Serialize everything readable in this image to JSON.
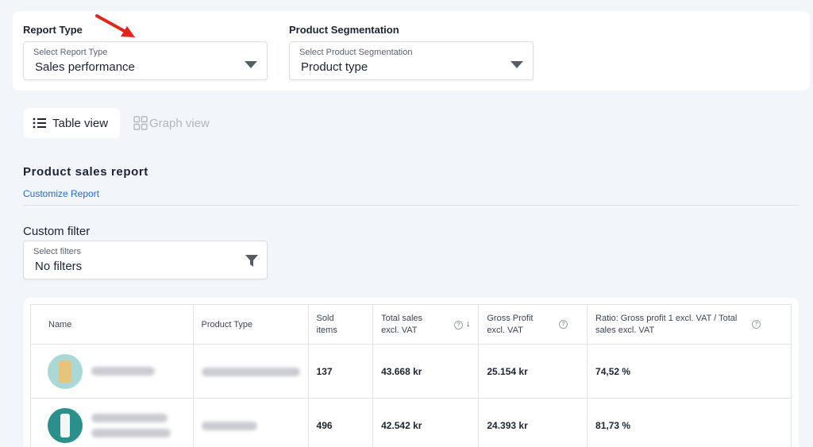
{
  "report_type": {
    "label": "Report Type",
    "caption": "Select Report Type",
    "value": "Sales performance"
  },
  "segmentation": {
    "label": "Product Segmentation",
    "caption": "Select Product Segmentation",
    "value": "Product type"
  },
  "views": {
    "table_label": "Table view",
    "graph_label": "Graph view"
  },
  "report": {
    "title": "Product sales report",
    "customize_link": "Customize Report"
  },
  "filter": {
    "label": "Custom filter",
    "caption": "Select filters",
    "value": "No filters"
  },
  "table": {
    "headers": {
      "name": "Name",
      "product_type": "Product Type",
      "sold_items": "Sold items",
      "total_sales": "Total sales excl. VAT",
      "gross_profit": "Gross Profit excl. VAT",
      "ratio": "Ratio: Gross profit 1 excl. VAT / Total sales excl. VAT"
    },
    "rows": [
      {
        "sold": "137",
        "total_sales": "43.668 kr",
        "gross_profit": "25.154 kr",
        "ratio": "74,52 %"
      },
      {
        "sold": "496",
        "total_sales": "42.542 kr",
        "gross_profit": "24.393 kr",
        "ratio": "81,73 %"
      }
    ]
  },
  "colors": {
    "accent_link": "#1f6fd1",
    "annotation_arrow": "#e0261b",
    "thumb_1": "#a9d8d6",
    "thumb_2": "#2b8f8a"
  },
  "icons": {
    "caret": "chevron-down-icon",
    "filter": "funnel-icon",
    "table_view": "list-icon",
    "graph_view": "grid-icon",
    "info": "info-icon",
    "sort": "arrow-down-icon"
  }
}
